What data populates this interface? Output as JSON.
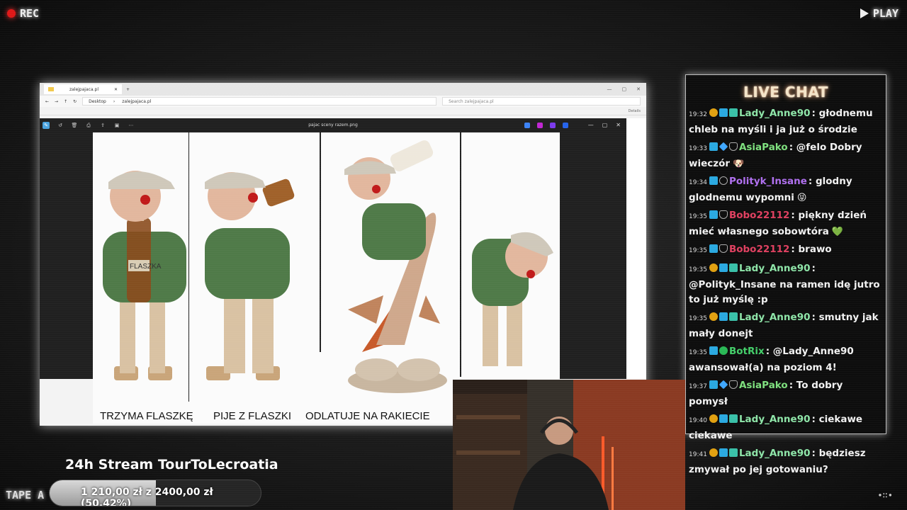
{
  "overlay": {
    "rec_label": "REC",
    "play_label": "PLAY",
    "tape_label": "TAPE A",
    "corner_glyph": "∙∷∙"
  },
  "explorer": {
    "tab_title": "zalejpajaca.pl",
    "breadcrumb_root": "Desktop",
    "breadcrumb_folder": "zalejpajaca.pl",
    "search_placeholder": "Search zalejpajaca.pl",
    "details_label": "Details"
  },
  "viewer": {
    "file_name": "pajac sceny razem.png",
    "captions": [
      "TRZYMA FLASZKĘ",
      "PIJE Z FLASZKI",
      "ODLATUJE NA RAKIECIE"
    ],
    "bottle_label": "FLASZKA"
  },
  "chat": {
    "title": "LIVE CHAT",
    "messages": [
      {
        "time": "19:32",
        "badges": [
          "sub",
          "prime",
          "grid"
        ],
        "user": "Lady_Anne90",
        "color": "#8ee5a8",
        "text": ": głodnemu chleb na myśli i ja już o środzie",
        "emoji": ""
      },
      {
        "time": "19:33",
        "badges": [
          "prime",
          "cube",
          "shield"
        ],
        "user": "AsiaPako",
        "color": "#7ee07e",
        "text": ": @felo Dobry wieczór",
        "emoji": "🐶"
      },
      {
        "time": "19:34",
        "badges": [
          "prime",
          "x"
        ],
        "user": "Polityk_Insane",
        "color": "#b070f0",
        "text": ": glodny glodnemu wypomni",
        "emoji": "😝"
      },
      {
        "time": "19:35",
        "badges": [
          "prime",
          "shield"
        ],
        "user": "Bobo22112",
        "color": "#e04060",
        "text": ": piękny dzień mieć własnego sobowtóra",
        "emoji": "💚"
      },
      {
        "time": "19:35",
        "badges": [
          "prime",
          "shield"
        ],
        "user": "Bobo22112",
        "color": "#e04060",
        "text": ": brawo",
        "emoji": ""
      },
      {
        "time": "19:35",
        "badges": [
          "sub",
          "prime",
          "grid"
        ],
        "user": "Lady_Anne90",
        "color": "#8ee5a8",
        "text": ": @Polityk_Insane na ramen idę jutro to już myślę :p",
        "emoji": ""
      },
      {
        "time": "19:35",
        "badges": [
          "sub",
          "prime",
          "grid"
        ],
        "user": "Lady_Anne90",
        "color": "#8ee5a8",
        "text": ": smutny jak mały donejt",
        "emoji": ""
      },
      {
        "time": "19:35",
        "badges": [
          "prime",
          "bot"
        ],
        "user": "BotRix",
        "color": "#44d06a",
        "text": ": @Lady_Anne90 awansował(a) na poziom 4!",
        "emoji": ""
      },
      {
        "time": "19:37",
        "badges": [
          "prime",
          "cube",
          "shield"
        ],
        "user": "AsiaPako",
        "color": "#7ee07e",
        "text": ": To dobry pomysł",
        "emoji": ""
      },
      {
        "time": "19:40",
        "badges": [
          "sub",
          "prime",
          "grid"
        ],
        "user": "Lady_Anne90",
        "color": "#8ee5a8",
        "text": ": ciekawe ciekawe",
        "emoji": ""
      },
      {
        "time": "19:41",
        "badges": [
          "sub",
          "prime",
          "grid"
        ],
        "user": "Lady_Anne90",
        "color": "#8ee5a8",
        "text": ": będziesz zmywał po jej gotowaniu?",
        "emoji": ""
      }
    ]
  },
  "stream": {
    "title": "24h Stream TourToLecroatia",
    "goal_text": "1 210,00 zł  z  2400,00 zł  (50.42%)",
    "goal_fraction": 0.5042
  }
}
